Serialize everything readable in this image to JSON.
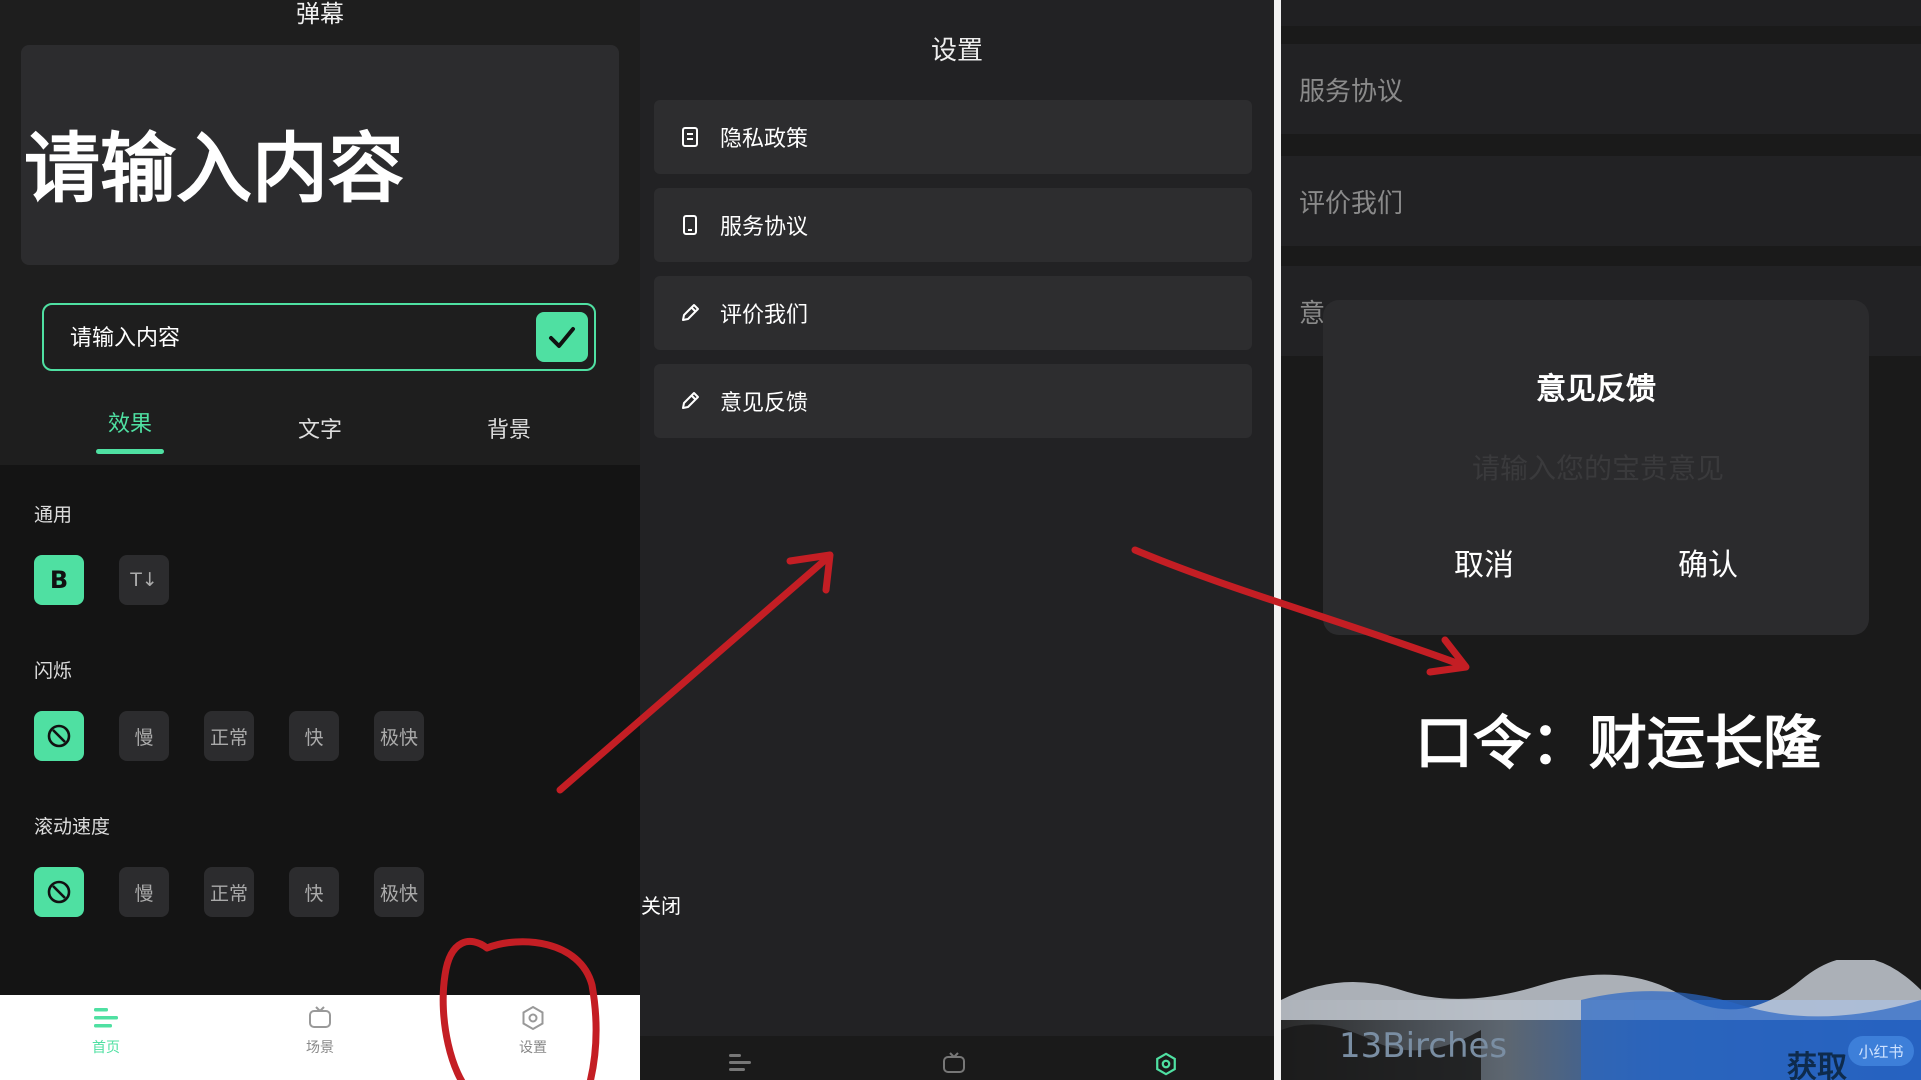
{
  "panel1": {
    "title": "弹幕",
    "preview_text": "请输入内容",
    "input_placeholder": "请输入内容",
    "tabs": [
      {
        "label": "效果",
        "active": true
      },
      {
        "label": "文字",
        "active": false
      },
      {
        "label": "背景",
        "active": false
      }
    ],
    "sections": {
      "general": {
        "label": "通用",
        "bold_label": "B",
        "size_label": "T↓"
      },
      "blink": {
        "label": "闪烁",
        "speeds": [
          "慢",
          "正常",
          "快",
          "极快"
        ]
      },
      "scroll": {
        "label": "滚动速度",
        "speeds": [
          "慢",
          "正常",
          "快",
          "极快"
        ]
      }
    },
    "nav": [
      {
        "label": "首页",
        "active": true
      },
      {
        "label": "场景",
        "active": false
      },
      {
        "label": "设置",
        "active": false
      }
    ]
  },
  "panel2": {
    "title": "设置",
    "menu": [
      {
        "label": "隐私政策",
        "icon": "document-icon"
      },
      {
        "label": "服务协议",
        "icon": "phone-icon"
      },
      {
        "label": "评价我们",
        "icon": "pencil-icon"
      },
      {
        "label": "意见反馈",
        "icon": "pencil-icon"
      }
    ],
    "close_label": "关闭"
  },
  "panel3": {
    "background_rows": [
      "服务协议",
      "评价我们",
      "意"
    ],
    "dialog": {
      "title": "意见反馈",
      "placeholder": "请输入您的宝贵意见",
      "cancel": "取消",
      "confirm": "确认"
    },
    "slogan": "口令：财运长隆",
    "photo_text": "13Birches",
    "get_text": "获取",
    "badge": "小红书"
  },
  "colors": {
    "accent": "#4fe0a2",
    "annotation_red": "#c41e24"
  }
}
